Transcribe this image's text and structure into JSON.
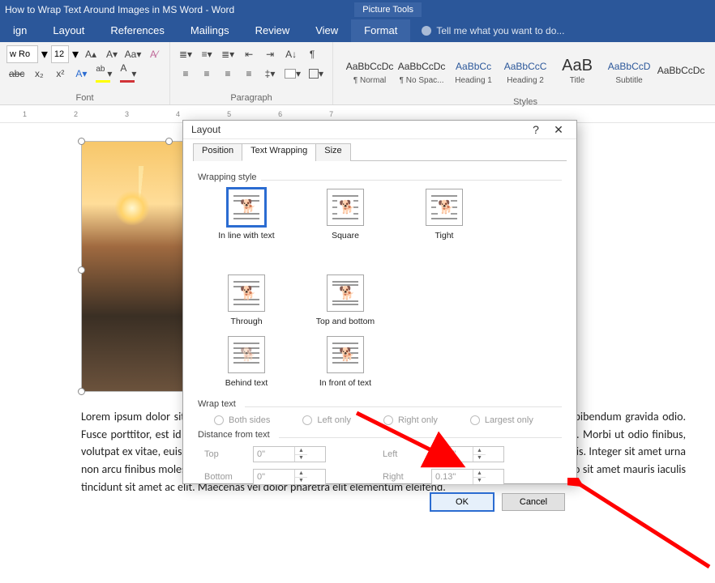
{
  "titlebar": {
    "title": "How to Wrap Text Around Images in MS Word - Word",
    "context_tab": "Picture Tools"
  },
  "tabs": {
    "items": [
      "ign",
      "Layout",
      "References",
      "Mailings",
      "Review",
      "View",
      "Format"
    ],
    "tell_me": "Tell me what you want to do..."
  },
  "ribbon": {
    "font_name": "w Ro",
    "font_size": "12",
    "group_font": "Font",
    "group_paragraph": "Paragraph",
    "group_styles": "Styles",
    "styles": [
      {
        "sample": "AaBbCcDc",
        "label": "¶ Normal"
      },
      {
        "sample": "AaBbCcDc",
        "label": "¶ No Spac..."
      },
      {
        "sample": "AaBbCc",
        "label": "Heading 1",
        "blue": true
      },
      {
        "sample": "AaBbCcC",
        "label": "Heading 2",
        "blue": true
      },
      {
        "sample": "AaB",
        "label": "Title",
        "large": true
      },
      {
        "sample": "AaBbCcD",
        "label": "Subtitle",
        "blue": true
      },
      {
        "sample": "AaBbCcDc",
        "label": ""
      }
    ]
  },
  "ruler": {
    "marks": [
      "1",
      "2",
      "3",
      "4",
      "5",
      "6",
      "7"
    ]
  },
  "document": {
    "body_text": "Lorem ipsum dolor sit amet, consectetur adipiscing elit. Donec lectus metus, hendrerit efficitur eros ac, bibendum gravida odio. Fusce porttitor, est id vehicula suscipit, lectus sapien condimentum nisi, quis aliquam eros risus sed enim. Morbi ut odio finibus, volutpat ex vitae, euismod augue. In ultrices lectus ex, eu bibendum neque cursus eu. Nunc sed auctor turpis. Integer sit amet urna non arcu finibus molestie. Suspendisse blandit felis a leo pellentesque, non rhoncus sapien porta. In at justo sit amet mauris iaculis tincidunt sit amet ac elit. Maecenas vel dolor pharetra elit elementum eleifend."
  },
  "dialog": {
    "title": "Layout",
    "tabs": {
      "position": "Position",
      "wrapping": "Text Wrapping",
      "size": "Size"
    },
    "wrapping_style_label": "Wrapping style",
    "wrap_options": {
      "inline": {
        "label": "In line with text",
        "underline_key": "I"
      },
      "square": {
        "label": "Square"
      },
      "tight": {
        "label": "Tight"
      },
      "through": {
        "label": "Through"
      },
      "topbot": {
        "label": "Top and bottom"
      },
      "behind": {
        "label": "Behind text"
      },
      "front": {
        "label": "In front of text"
      }
    },
    "wrap_text_label": "Wrap text",
    "wrap_text_options": {
      "both": "Both sides",
      "left": "Left only",
      "right": "Right only",
      "largest": "Largest only"
    },
    "distance_label": "Distance from text",
    "distance": {
      "top_label": "Top",
      "top": "0\"",
      "bottom_label": "Bottom",
      "bottom": "0\"",
      "left_label": "Left",
      "left": "0.13\"",
      "right_label": "Right",
      "right": "0.13\""
    },
    "buttons": {
      "ok": "OK",
      "cancel": "Cancel"
    }
  }
}
